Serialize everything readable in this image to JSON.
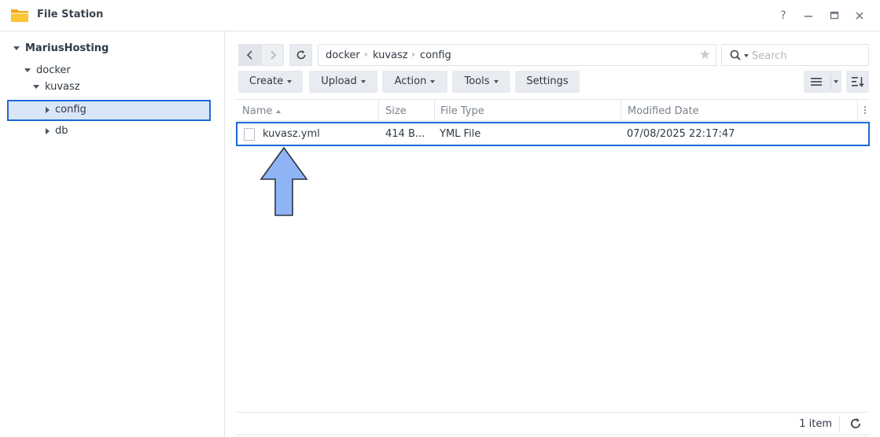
{
  "window": {
    "title": "File Station",
    "controls": {
      "help": "?",
      "minimize": "—",
      "maximize": "▭",
      "close": "✕"
    }
  },
  "sidebar": {
    "root": "MariusHosting",
    "items": [
      {
        "label": "docker"
      },
      {
        "label": "kuvasz"
      },
      {
        "label": "config"
      },
      {
        "label": "db"
      }
    ]
  },
  "breadcrumb": [
    "docker",
    "kuvasz",
    "config"
  ],
  "search": {
    "placeholder": "Search",
    "value": ""
  },
  "toolbar": {
    "create": "Create",
    "upload": "Upload",
    "action": "Action",
    "tools": "Tools",
    "settings": "Settings"
  },
  "columns": {
    "name": "Name",
    "size": "Size",
    "type": "File Type",
    "modified": "Modified Date"
  },
  "files": [
    {
      "name": "kuvasz.yml",
      "size": "414 B...",
      "type": "YML File",
      "modified": "07/08/2025 22:17:47"
    }
  ],
  "status": {
    "count": "1 item"
  },
  "colors": {
    "accent": "#1c6bd8",
    "selection": "#d9e6f7",
    "arrow": "#8fb4f5"
  }
}
